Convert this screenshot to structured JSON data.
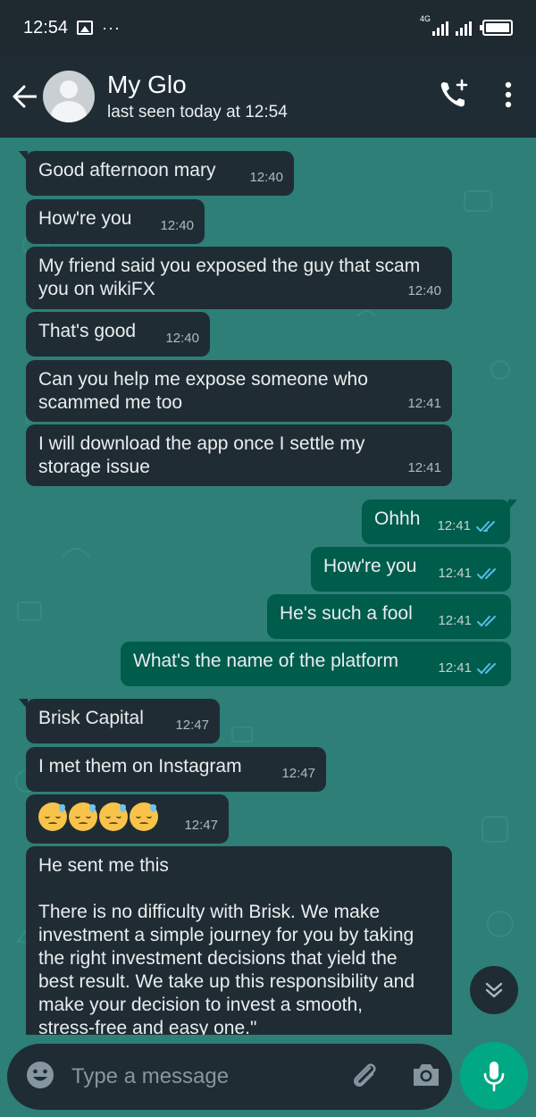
{
  "status_bar": {
    "time": "12:54",
    "more": "···",
    "network": "4G"
  },
  "header": {
    "contact_name": "My Glo",
    "contact_status": "last seen today at 12:54"
  },
  "messages": [
    {
      "dir": "in",
      "text": "Good afternoon mary",
      "time": "12:40"
    },
    {
      "dir": "in",
      "text": "How're you",
      "time": "12:40"
    },
    {
      "dir": "in",
      "text": "My friend said you exposed the guy that scam you on wikiFX",
      "time": "12:40"
    },
    {
      "dir": "in",
      "text": "That's good",
      "time": "12:40"
    },
    {
      "dir": "in",
      "text": "Can you help me expose someone who scammed me too",
      "time": "12:41"
    },
    {
      "dir": "in",
      "text": "I will download the app once I settle my storage issue",
      "time": "12:41"
    },
    {
      "dir": "out",
      "text": "Ohhh",
      "time": "12:41"
    },
    {
      "dir": "out",
      "text": "How're you",
      "time": "12:41"
    },
    {
      "dir": "out",
      "text": "He's such a fool",
      "time": "12:41"
    },
    {
      "dir": "out",
      "text": "What's the name of the platform",
      "time": "12:41"
    },
    {
      "dir": "in",
      "text": "Brisk Capital",
      "time": "12:47"
    },
    {
      "dir": "in",
      "text": "I met them on Instagram",
      "time": "12:47"
    },
    {
      "dir": "in",
      "text": "",
      "emoji_count": 4,
      "time": "12:47"
    },
    {
      "dir": "in",
      "text": "He sent me this\n\nThere is no difficulty with Brisk. We make investment a simple journey for you by taking the right investment decisions that yield the best result. We take up this responsibility and make your decision to invest a smooth, stress-free and easy one.\"",
      "time": ""
    }
  ],
  "input": {
    "placeholder": "Type a message"
  },
  "colors": {
    "header_bg": "#1f2c33",
    "chat_bg": "#2d7f78",
    "incoming_bubble": "#202c33",
    "outgoing_bubble": "#005c4b",
    "accent": "#00a884",
    "read_ticks": "#53bdeb"
  },
  "icons": {
    "back": "arrow-left-icon",
    "add_call": "phone-plus-icon",
    "menu": "vertical-dots-icon",
    "emoji": "emoji-icon",
    "attach": "paperclip-icon",
    "camera": "camera-icon",
    "mic": "microphone-icon",
    "scroll": "double-chevron-down-icon"
  }
}
